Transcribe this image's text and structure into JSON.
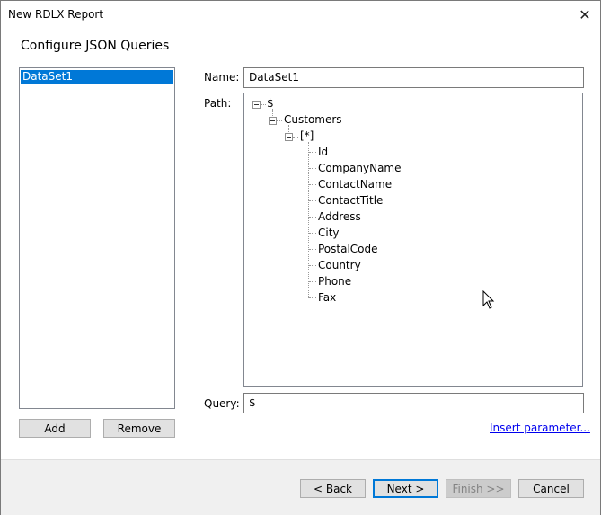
{
  "window": {
    "title": "New RDLX Report",
    "close_label": "✕"
  },
  "heading": "Configure JSON Queries",
  "datasets": {
    "items": [
      {
        "label": "DataSet1",
        "selected": true
      }
    ]
  },
  "buttons": {
    "add": "Add",
    "remove": "Remove",
    "back": "< Back",
    "next": "Next >",
    "finish": "Finish >>",
    "cancel": "Cancel"
  },
  "name_field": {
    "label": "Name:",
    "value": "DataSet1"
  },
  "path_field": {
    "label": "Path:"
  },
  "tree": {
    "root": "$",
    "customers": "Customers",
    "array": "[*]",
    "fields": [
      "Id",
      "CompanyName",
      "ContactName",
      "ContactTitle",
      "Address",
      "City",
      "PostalCode",
      "Country",
      "Phone",
      "Fax"
    ]
  },
  "query_field": {
    "label": "Query:",
    "value": "$"
  },
  "insert_parameter": "Insert parameter...",
  "colors": {
    "selection": "#0078d7",
    "link": "#0000ee",
    "footer": "#f0f0f0"
  }
}
